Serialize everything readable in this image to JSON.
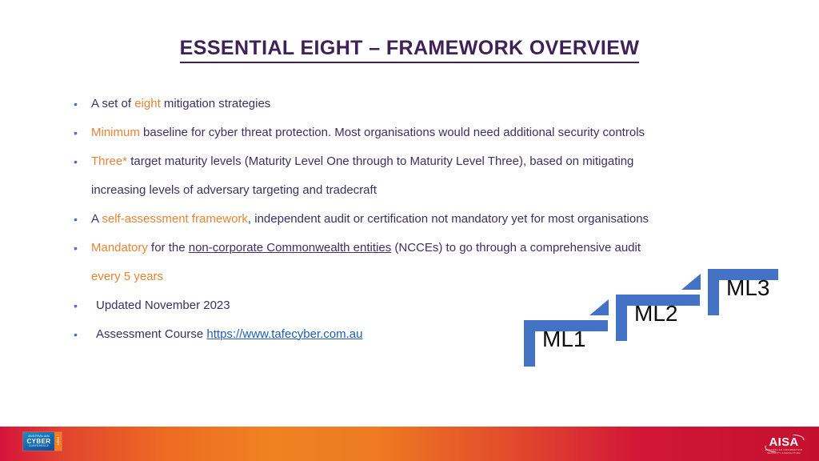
{
  "slide": {
    "title": "ESSENTIAL EIGHT – FRAMEWORK OVERVIEW",
    "background_color": "#FFFFFF",
    "title_color": "#3E2157",
    "body_color": "#3B2F63",
    "accent_orange": "#E68436",
    "link_color": "#1F5FB5",
    "diagram_blue": "#4472C4"
  },
  "bullets": [
    {
      "id": "bullet-1",
      "segments": [
        {
          "text": "A set of ",
          "style": "normal"
        },
        {
          "text": "eight",
          "style": "orange"
        },
        {
          "text": " mitigation strategies",
          "style": "normal"
        }
      ]
    },
    {
      "id": "bullet-2",
      "segments": [
        {
          "text": "Minimum",
          "style": "orange"
        },
        {
          "text": " baseline for cyber threat protection. Most organisations would need additional security controls",
          "style": "normal"
        }
      ]
    },
    {
      "id": "bullet-3",
      "segments": [
        {
          "text": "Three*",
          "style": "orange"
        },
        {
          "text": " target maturity levels (Maturity Level One through to Maturity Level Three), based on mitigating",
          "style": "normal"
        }
      ],
      "continuation": "increasing levels of adversary targeting and tradecraft"
    },
    {
      "id": "bullet-4",
      "segments": [
        {
          "text": "A ",
          "style": "normal"
        },
        {
          "text": "self-assessment framework",
          "style": "orange"
        },
        {
          "text": ", independent audit or certification not mandatory yet for most organisations",
          "style": "normal"
        }
      ]
    },
    {
      "id": "bullet-5",
      "segments": [
        {
          "text": "Mandatory",
          "style": "orange"
        },
        {
          "text": " for the ",
          "style": "normal"
        },
        {
          "text": "non-corporate Commonwealth entities",
          "style": "underline"
        },
        {
          "text": " (NCCEs) to go through a comprehensive audit",
          "style": "normal"
        }
      ],
      "continuation_orange": "every 5 years"
    },
    {
      "id": "bullet-6",
      "segments": [
        {
          "text": " Updated November 2023",
          "style": "normal"
        }
      ]
    },
    {
      "id": "bullet-7",
      "segments": [
        {
          "text": " Assessment Course ",
          "style": "normal"
        },
        {
          "text": "https://www.tafecyber.com.au",
          "style": "link"
        }
      ]
    }
  ],
  "bullet_marker": "•",
  "diagram": {
    "name": "maturity-level-staircase",
    "steps": [
      {
        "label": "ML1"
      },
      {
        "label": "ML2"
      },
      {
        "label": "ML3"
      }
    ]
  },
  "footer": {
    "conference_logo": {
      "line1": "AUSTRALIAN",
      "line2": "CYBER",
      "line3": "CONFERENCE",
      "year": "2024"
    },
    "org_logo": {
      "name": "AISA",
      "subtitle": "AUSTRALIAN INFORMATION SECURITY ASSOCIATION"
    }
  }
}
